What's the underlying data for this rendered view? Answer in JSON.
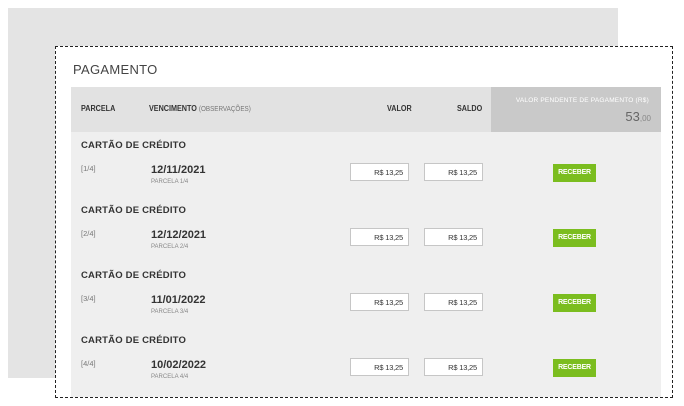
{
  "section_title": "PAGAMENTO",
  "header": {
    "parcela": "PARCELA",
    "vencimento": "VENCIMENTO",
    "observacoes": "(OBSERVAÇÕES)",
    "valor": "VALOR",
    "saldo": "SALDO",
    "pendente_label": "VALOR PENDENTE DE PAGAMENTO (R$)",
    "pendente_int": "53",
    "pendente_dec": ",00"
  },
  "rows": [
    {
      "method": "CARTÃO DE CRÉDITO",
      "num": "[1/4]",
      "date": "12/11/2021",
      "obs": "PARCELA 1/4",
      "valor": "R$ 13,25",
      "saldo": "R$ 13,25",
      "button": "RECEBER"
    },
    {
      "method": "CARTÃO DE CRÉDITO",
      "num": "[2/4]",
      "date": "12/12/2021",
      "obs": "PARCELA 2/4",
      "valor": "R$ 13,25",
      "saldo": "R$ 13,25",
      "button": "RECEBER"
    },
    {
      "method": "CARTÃO DE CRÉDITO",
      "num": "[3/4]",
      "date": "11/01/2022",
      "obs": "PARCELA 3/4",
      "valor": "R$ 13,25",
      "saldo": "R$ 13,25",
      "button": "RECEBER"
    },
    {
      "method": "CARTÃO DE CRÉDITO",
      "num": "[4/4]",
      "date": "10/02/2022",
      "obs": "PARCELA 4/4",
      "valor": "R$ 13,25",
      "saldo": "R$ 13,25",
      "button": "RECEBER"
    }
  ],
  "colors": {
    "accent_button": "#7bbd1f",
    "header_bg": "#e2e2e2",
    "pending_bg": "#c9c9c9",
    "rows_bg": "#efefef"
  }
}
